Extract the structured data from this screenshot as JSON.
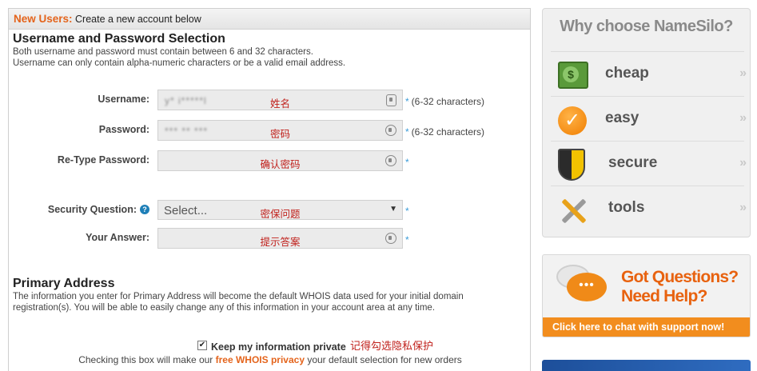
{
  "header": {
    "highlight": "New Users:",
    "text": "Create a new account below"
  },
  "credentials": {
    "title": "Username and Password Selection",
    "desc1": "Both username and password must contain between 6 and 32 characters.",
    "desc2": "Username can only contain alpha-numeric characters or be a valid email address."
  },
  "form": {
    "username": {
      "label": "Username:",
      "value": "y* i*****l",
      "hint": "姓名",
      "note": "(6-32 characters)"
    },
    "password": {
      "label": "Password:",
      "value": "*** ** ***",
      "hint": "密码",
      "note": "(6-32 characters)"
    },
    "retype": {
      "label": "Re-Type Password:",
      "hint": "确认密码"
    },
    "security": {
      "label": "Security Question:",
      "selected": "Select...",
      "hint": "密保问题",
      "help_icon": "?"
    },
    "answer": {
      "label": "Your Answer:",
      "hint": "提示答案"
    },
    "required_mark": "*"
  },
  "address": {
    "title": "Primary Address",
    "desc1": "The information you enter for Primary Address will become the default WHOIS data used for your initial domain",
    "desc2": "registration(s). You will be able to easily change any of this information in your account area at any time."
  },
  "privacy": {
    "label": "Keep my information private",
    "hint": "记得勾选隐私保护",
    "desc_before": "Checking this box will make our ",
    "desc_link": "free WHOIS privacy",
    "desc_after": " your default selection for new orders",
    "checked": true
  },
  "sidebar": {
    "title": "Why choose NameSilo?",
    "items": [
      {
        "label": "cheap",
        "icon": "money-icon"
      },
      {
        "label": "easy",
        "icon": "checkmark-icon"
      },
      {
        "label": "secure",
        "icon": "shield-icon"
      },
      {
        "label": "tools",
        "icon": "tools-icon"
      }
    ],
    "chevron": "»"
  },
  "help": {
    "line1": "Got Questions?",
    "line2": "Need Help?",
    "cta": "Click here to chat with support now!"
  },
  "colors": {
    "accent": "#e4641c",
    "hint_red": "#c0211c",
    "required_blue": "#3a9bd8"
  }
}
